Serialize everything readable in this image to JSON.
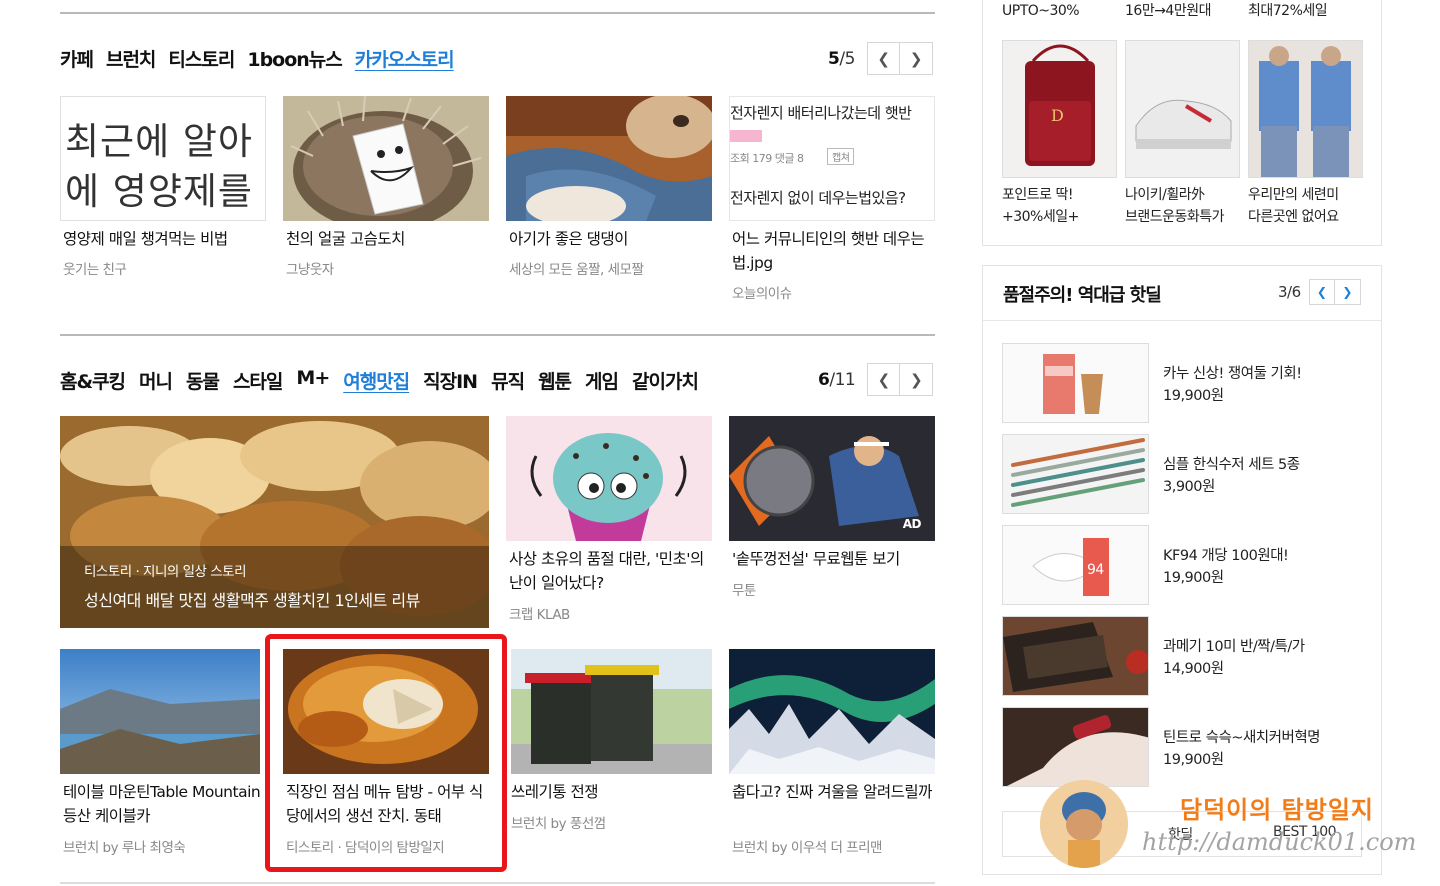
{
  "section_a": {
    "tabs": [
      "카페",
      "브런치",
      "티스토리",
      "1boon뉴스",
      "카카오스토리"
    ],
    "active_tab": 4,
    "page_current": "5",
    "page_total": "/5",
    "cards": [
      {
        "thumb_text_line1": "최근에 알아",
        "thumb_text_line2": "에 영양제를",
        "title": "영양제 매일 챙겨먹는 비법",
        "source": "웃기는 친구"
      },
      {
        "title": "천의 얼굴 고슴도치",
        "source": "그냥웃자"
      },
      {
        "title": "아기가 좋은 댕댕이",
        "source": "세상의 모든 움짤, 세모짤"
      },
      {
        "thumb_text_line1": "전자렌지 배터리나갔는데 햇반",
        "thumb_meta": "조회 179 댓글 8",
        "thumb_badge": "캡쳐",
        "thumb_text_line2": "전자렌지 없이 데우는법있음?",
        "title": "어느 커뮤니티인의 햇반 데우는 법.jpg",
        "source": "오늘의이슈"
      }
    ]
  },
  "section_b": {
    "tabs": [
      "홈&쿠킹",
      "머니",
      "동물",
      "스타일",
      "M+",
      "여행맛집",
      "직장IN",
      "뮤직",
      "웹툰",
      "게임",
      "같이가치"
    ],
    "active_tab": 5,
    "page_current": "6",
    "page_total": "/11",
    "feature": {
      "overlay_source": "티스토리 · 지니의 일상 스토리",
      "overlay_title": "성신여대 배달 맛집 생활맥주 생활치킨 1인세트 리뷰"
    },
    "cards_top": [
      {
        "title": "사상 초유의 품절 대란, '민초'의 난이 일어났다?",
        "source": "크랩 KLAB"
      },
      {
        "title": "'솥뚜껑전설' 무료웹툰 보기",
        "source": "무툰",
        "ad": "AD"
      }
    ],
    "cards_bottom": [
      {
        "title": "테이블 마운틴Table Mountain 등산 케이블카",
        "source": "브런치 by 루나 최영숙"
      },
      {
        "title": "직장인 점심 메뉴 탐방 - 어부 식당에서의 생선 잔치. 동태",
        "source": "티스토리 · 담덕이의 탐방일지"
      },
      {
        "title": "쓰레기통 전쟁",
        "source": "브런치 by 풍선껌"
      },
      {
        "title": "춥다고? 진짜 겨울을 알려드릴까",
        "source": "브런치 by 이우석 더 프리맨"
      }
    ]
  },
  "shopping_top": {
    "labels": [
      "UPTO~30%",
      "16만→4만원대",
      "최대72%세일"
    ],
    "items": [
      {
        "line1": "포인트로 딱!",
        "line2": "+30%세일+"
      },
      {
        "line1": "나이키/휠라外",
        "line2": "브랜드운동화특가"
      },
      {
        "line1": "우리만의 세련미",
        "line2": "다른곳엔 없어요"
      }
    ]
  },
  "hot_deal": {
    "title": "품절주의! 역대급 핫딜",
    "page_current": "3",
    "page_total": "/6",
    "items": [
      {
        "name": "카누 신상! 쟁여둘 기회!",
        "price": "19,900원"
      },
      {
        "name": "심플 한식수저 세트 5종",
        "price": "3,900원"
      },
      {
        "name": "KF94 개당 100원대!",
        "price": "19,900원"
      },
      {
        "name": "과메기 10미 반/짝/특/가",
        "price": "14,900원"
      },
      {
        "name": "틴트로 슥슥~새치커버혁명",
        "price": "19,900원"
      }
    ],
    "mask_badge": "94",
    "footer_tabs": [
      "핫딜",
      "BEST 100"
    ]
  },
  "watermark": {
    "title": "담덕이의 탐방일지",
    "url": "http://damduck01.com"
  },
  "colors": {
    "accent": "#1e7ed8",
    "highlight_box": "#e8151b",
    "rule": "#b9b9b9"
  }
}
